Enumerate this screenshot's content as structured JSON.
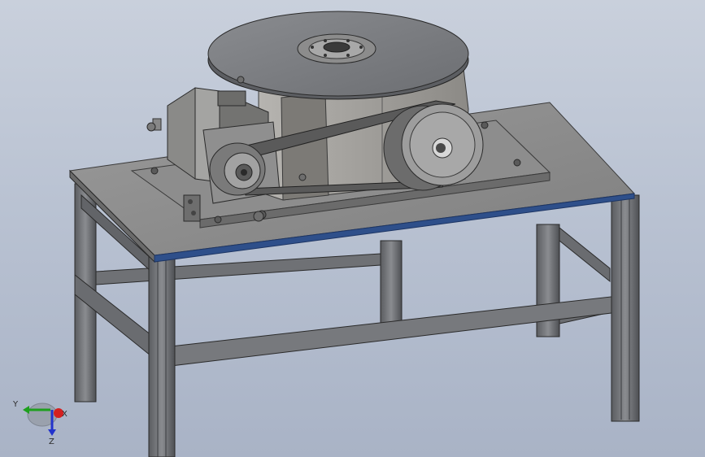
{
  "viewport": {
    "background_top": "#c9d0dc",
    "background_bottom": "#a9b3c6"
  },
  "model": {
    "parts": [
      "turntable-disc",
      "gearbox-housing",
      "servo-motor",
      "drive-pulley",
      "driven-pulley",
      "timing-belt",
      "mounting-plate",
      "table-top",
      "aluminum-profile-frame"
    ],
    "colors": {
      "steel": "#8e8e8e",
      "steel_dark": "#5f5f5f",
      "profile": "#707276",
      "edge_accent": "#2e4f8a"
    }
  },
  "triad": {
    "x_label": "X",
    "y_label": "Y",
    "z_label": "Z",
    "x_color": "#d42020",
    "y_color": "#1ea01e",
    "z_color": "#2233cc"
  }
}
